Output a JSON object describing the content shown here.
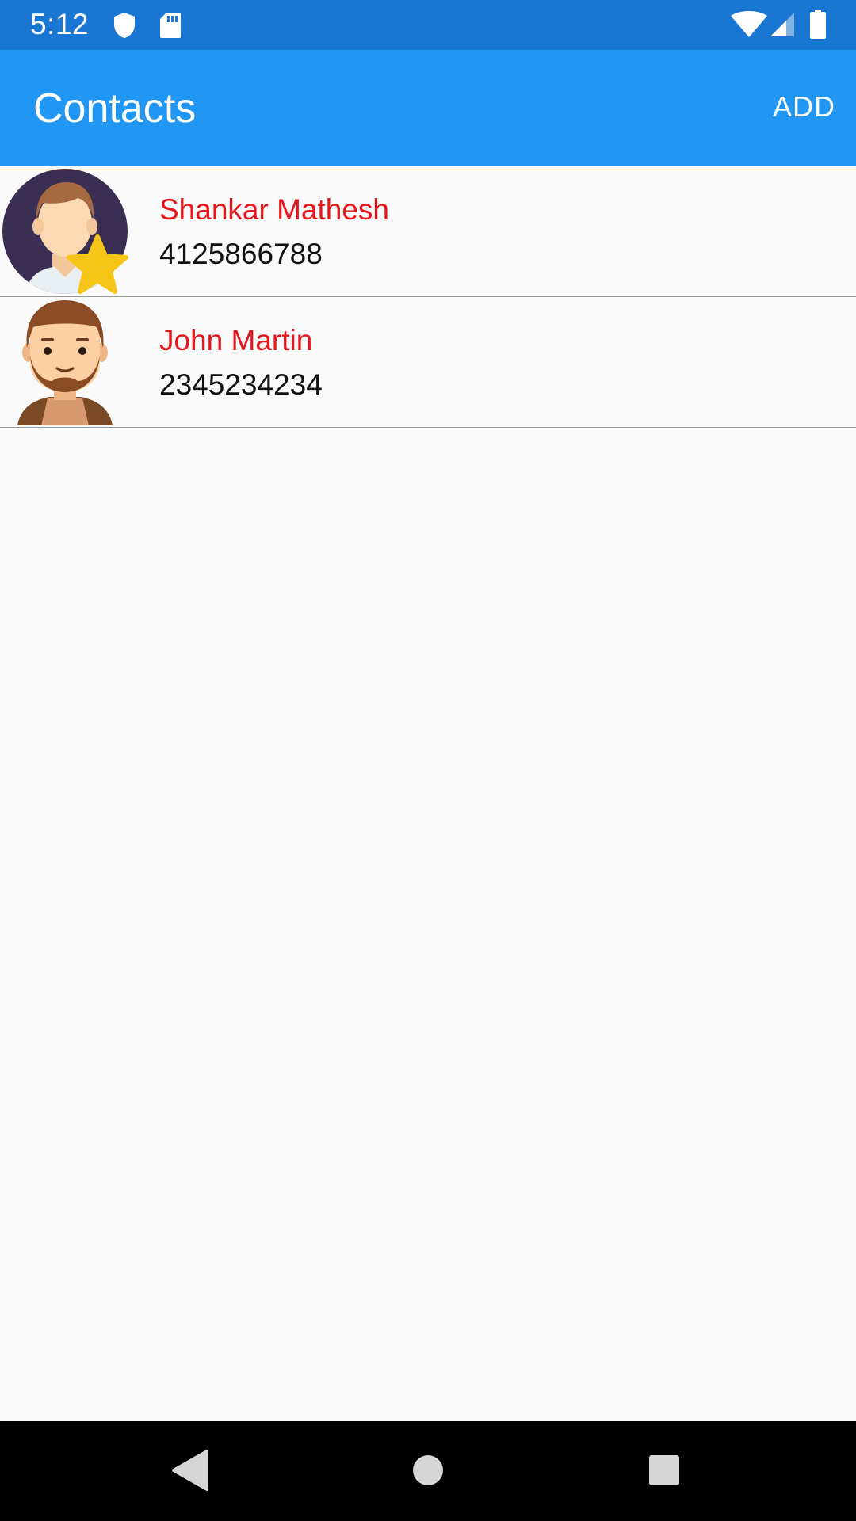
{
  "status_bar": {
    "time": "5:12",
    "icons": [
      "shield-icon",
      "sd-card-icon",
      "wifi-icon",
      "cell-signal-icon",
      "battery-icon"
    ]
  },
  "app_bar": {
    "title": "Contacts",
    "add_label": "ADD",
    "color": "#2196f3",
    "status_color": "#1976d2"
  },
  "contacts": [
    {
      "name": "Shankar Mathesh",
      "phone": "4125866788",
      "avatar": "avatar-favorite-star",
      "favorite": true
    },
    {
      "name": "John Martin",
      "phone": "2345234234",
      "avatar": "avatar-bearded-man",
      "favorite": false
    }
  ],
  "colors": {
    "name_text": "#e8141c",
    "phone_text": "#111111",
    "divider": "#9a9a9a",
    "background": "#fafafa"
  },
  "nav_bar": {
    "buttons": [
      "back-icon",
      "home-icon",
      "recents-icon"
    ]
  }
}
